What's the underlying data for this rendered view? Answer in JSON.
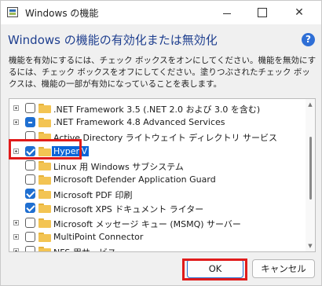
{
  "window": {
    "title": "Windows の機能",
    "minimize_icon": "minimize-icon",
    "maximize_icon": "maximize-icon",
    "close_icon": "close-icon",
    "close_glyph": "✕"
  },
  "header": {
    "heading": "Windows の機能の有効化または無効化",
    "help_glyph": "?"
  },
  "description": "機能を有効にするには、チェック ボックスをオンにしてください。機能を無効にするには、チェック ボックスをオフにしてください。塗りつぶされたチェック ボックスは、機能の一部が有効になっていることを表します。",
  "features": [
    {
      "label": ".NET Framework 3.5 (.NET 2.0 および 3.0 を含む)",
      "state": "unchecked",
      "expandable": true,
      "selected": false
    },
    {
      "label": ".NET Framework 4.8 Advanced Services",
      "state": "partial",
      "expandable": true,
      "selected": false
    },
    {
      "label": "Active Directory ライトウェイト ディレクトリ サービス",
      "state": "unchecked",
      "expandable": false,
      "selected": false
    },
    {
      "label": "Hyper-V",
      "state": "checked",
      "expandable": true,
      "selected": true
    },
    {
      "label": "Linux 用 Windows サブシステム",
      "state": "unchecked",
      "expandable": false,
      "selected": false
    },
    {
      "label": "Microsoft Defender Application Guard",
      "state": "unchecked",
      "expandable": false,
      "selected": false
    },
    {
      "label": "Microsoft PDF 印刷",
      "state": "checked",
      "expandable": false,
      "selected": false
    },
    {
      "label": "Microsoft XPS ドキュメント ライター",
      "state": "checked",
      "expandable": false,
      "selected": false
    },
    {
      "label": "Microsoft メッセージ キュー (MSMQ) サーバー",
      "state": "unchecked",
      "expandable": true,
      "selected": false
    },
    {
      "label": "MultiPoint Connector",
      "state": "unchecked",
      "expandable": true,
      "selected": false
    },
    {
      "label": "NFS 用サービス",
      "state": "unchecked",
      "expandable": true,
      "selected": false
    }
  ],
  "buttons": {
    "ok": "OK",
    "cancel": "キャンセル"
  },
  "colors": {
    "highlight": "#e01b1b",
    "selection": "#0a64d8",
    "checkbox_fill": "#1f6fd1"
  }
}
